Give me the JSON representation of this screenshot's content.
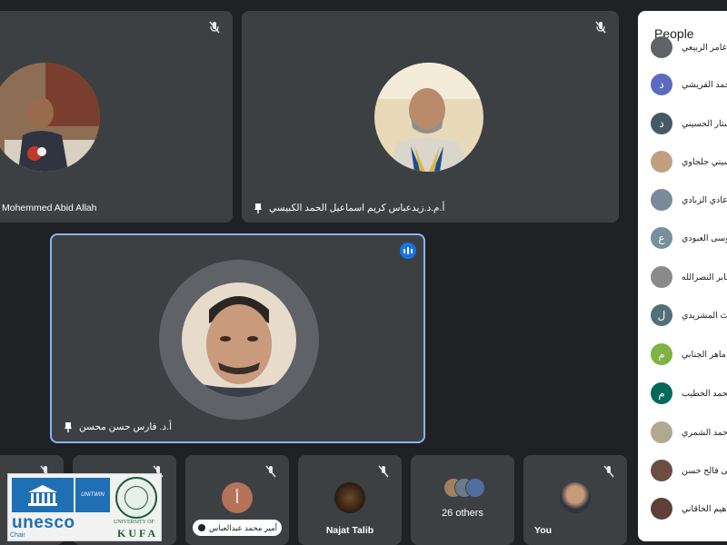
{
  "tiles": {
    "t1": {
      "name": "Mohemmed Abid Allah",
      "muted": true
    },
    "t2": {
      "name": "أ.م.د.زيدعباس كريم اسماعيل الحمد الكبيسي",
      "muted": true
    },
    "t3": {
      "name": "أ.د. فارس حسن محسن",
      "speaking": true
    },
    "s1": {
      "name": "",
      "muted": true
    },
    "s2": {
      "name": "",
      "muted": true
    },
    "s3": {
      "name": "أمير محمد عبدالعباس",
      "initial": "أ",
      "muted": true
    },
    "s4": {
      "name": "Najat Talib",
      "muted": true
    },
    "s5": {
      "name": "26 others"
    },
    "s6": {
      "name": "You",
      "muted": true
    }
  },
  "people": {
    "title": "People",
    "items": [
      {
        "name": "عامر الربيعي",
        "initial": "",
        "color": "#5f6368"
      },
      {
        "name": "محمد القريشي",
        "initial": "د",
        "color": "#5c6bc0"
      },
      {
        "name": "ستار الحسيني",
        "initial": "د",
        "color": "#455a64"
      },
      {
        "name": "حسيني جلجاوي",
        "initial": "",
        "color": "#c0a080"
      },
      {
        "name": "عادي الزبادي",
        "initial": "",
        "color": "#7a8a9a"
      },
      {
        "name": "موسى العبودي",
        "initial": "ع",
        "color": "#78909c"
      },
      {
        "name": "جابر النصرالله",
        "initial": "",
        "color": "#8a8a8a"
      },
      {
        "name": "ليث المشريدي",
        "initial": "ل",
        "color": "#546e7a"
      },
      {
        "name": "ماهر الجنابي",
        "initial": "م",
        "color": "#7cb342"
      },
      {
        "name": "محمد الخطيب",
        "initial": "م",
        "color": "#00695c"
      },
      {
        "name": "احمد الشمري",
        "initial": "",
        "color": "#b0a890"
      },
      {
        "name": "على فالح حسن",
        "initial": "",
        "color": "#6d4c41"
      },
      {
        "name": "راهيم الخاقاني",
        "initial": "",
        "color": "#5d4037"
      }
    ]
  },
  "logo": {
    "unesco": "unesco",
    "unitwin": "UNITWIN",
    "chair": "Chair",
    "university": "UNIVERSITY OF",
    "kufa": "KUFA"
  },
  "colors": {
    "background": "#202124",
    "tile": "#3c4043",
    "accent": "#8ab4f8",
    "speaking": "#1a73e8"
  }
}
